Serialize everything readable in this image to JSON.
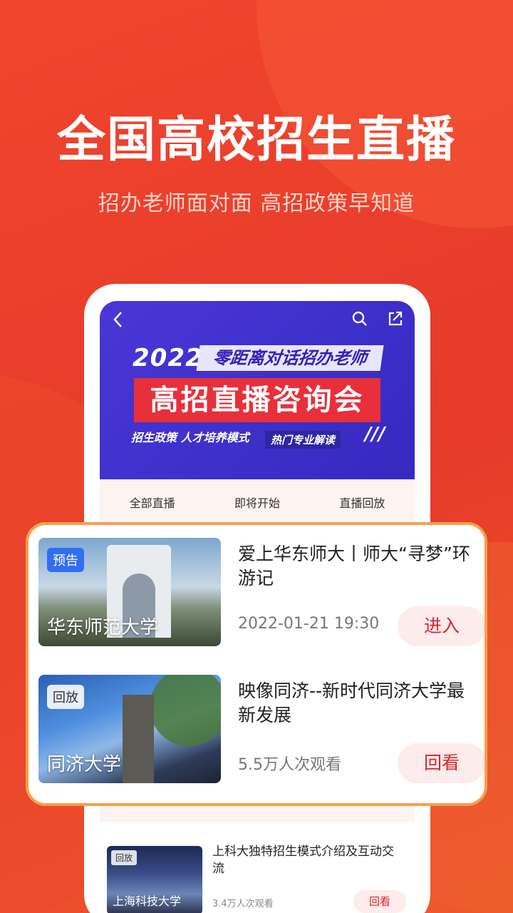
{
  "promo": {
    "headline": "全国高校招生直播",
    "subheadline": "招办老师面对面  高招政策早知道"
  },
  "banner": {
    "year": "2022",
    "top_line": "零距离对话招办老师",
    "main_title": "高招直播咨询会",
    "tags_text": "招生政策  人才培养模式",
    "tag3": "热门专业解读",
    "slashes": "///"
  },
  "tabs": [
    {
      "label": "全部直播"
    },
    {
      "label": "即将开始"
    },
    {
      "label": "直播回放"
    }
  ],
  "featured": [
    {
      "badge": "预告",
      "school": "华东师范大学",
      "title": "爱上华东师大丨师大“寻梦”环游记",
      "meta": "2022-01-21 19:30",
      "button": "进入"
    },
    {
      "badge": "回放",
      "school": "同济大学",
      "title": "映像同济--新时代同济大学最新发展",
      "meta": "5.5万人次观看",
      "button": "回看"
    }
  ],
  "list_item": {
    "badge": "回放",
    "school": "上海科技大学",
    "title": "上科大独特招生模式介绍及互动交流",
    "meta": "3.4万人次观看",
    "button": "回看"
  },
  "colors": {
    "accent_red": "#e8402a",
    "banner_purple": "#3d2fc9",
    "card_border": "#f6a04a",
    "button_text": "#d8262c"
  }
}
